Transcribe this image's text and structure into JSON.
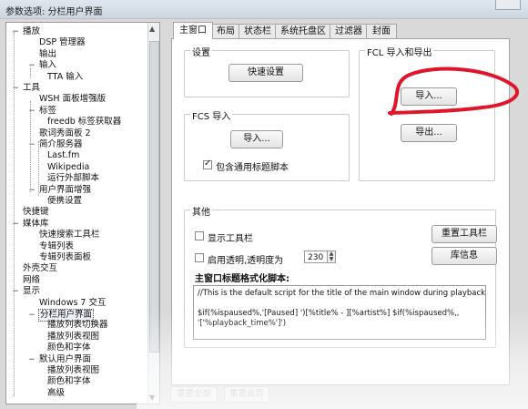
{
  "window": {
    "title": "参数选项: 分栏用户界面"
  },
  "tree": {
    "items": [
      {
        "label": "播放",
        "exp": "−"
      },
      {
        "label": "DSP 管理器",
        "exp": ""
      },
      {
        "label": "输出",
        "exp": ""
      },
      {
        "label": "输入",
        "exp": "−"
      },
      {
        "label": "TTA 输入",
        "exp": ""
      },
      {
        "label": "工具",
        "exp": "−"
      },
      {
        "label": "WSH 面板增强版",
        "exp": ""
      },
      {
        "label": "标签",
        "exp": "−"
      },
      {
        "label": "freedb 标签获取器",
        "exp": ""
      },
      {
        "label": "歌词秀面板 2",
        "exp": ""
      },
      {
        "label": "简介服务器",
        "exp": "−"
      },
      {
        "label": "Last.fm",
        "exp": ""
      },
      {
        "label": "Wikipedia",
        "exp": ""
      },
      {
        "label": "运行外部脚本",
        "exp": ""
      },
      {
        "label": "用户界面增强",
        "exp": "−"
      },
      {
        "label": "便携设置",
        "exp": ""
      },
      {
        "label": "快捷键",
        "exp": ""
      },
      {
        "label": "媒体库",
        "exp": "−"
      },
      {
        "label": "快速搜索工具栏",
        "exp": ""
      },
      {
        "label": "专辑列表",
        "exp": ""
      },
      {
        "label": "专辑列表面板",
        "exp": ""
      },
      {
        "label": "外壳交互",
        "exp": ""
      },
      {
        "label": "网络",
        "exp": ""
      },
      {
        "label": "显示",
        "exp": "−"
      },
      {
        "label": "Windows 7 交互",
        "exp": ""
      },
      {
        "label": "分栏用户界面",
        "exp": "−"
      },
      {
        "label": "播放列表切换器",
        "exp": ""
      },
      {
        "label": "播放列表视图",
        "exp": ""
      },
      {
        "label": "颜色和字体",
        "exp": ""
      },
      {
        "label": "默认用户界面",
        "exp": "−"
      },
      {
        "label": "播放列表视图",
        "exp": ""
      },
      {
        "label": "颜色和字体",
        "exp": ""
      },
      {
        "label": "高级",
        "exp": ""
      }
    ]
  },
  "tabs": [
    "主窗口",
    "布局",
    "状态栏",
    "系统托盘区",
    "过滤器",
    "封面"
  ],
  "settings_group": {
    "title": "设置",
    "quick_setup": "快速设置"
  },
  "fcs_group": {
    "title": "FCS 导入",
    "import": "导入...",
    "include_label": "包含通用标题脚本",
    "include_checked": true
  },
  "fcl_group": {
    "title": "FCL 导入和导出",
    "import": "导入...",
    "export": "导出..."
  },
  "other_group": {
    "title": "其他",
    "show_toolbar": "显示工具栏",
    "show_toolbar_checked": false,
    "transparency": "启用透明,透明度为",
    "transparency_checked": false,
    "transparency_value": "230",
    "reset_toolbar": "重置工具栏",
    "library_info": "库信息",
    "script_label": "主窗口标题格式化脚本:",
    "script_text": "//This is the default script for the title of the main window during playback.\n\n$if(%ispaused%,'[Paused] ')[%title% - ][%artist%] $if(%ispaused%,,\n'['%playback_time%']')"
  },
  "bottom": {
    "reset_all": "重置全部",
    "reset_page": "重置此页"
  },
  "colors": {
    "annotation": "#e0142a"
  }
}
